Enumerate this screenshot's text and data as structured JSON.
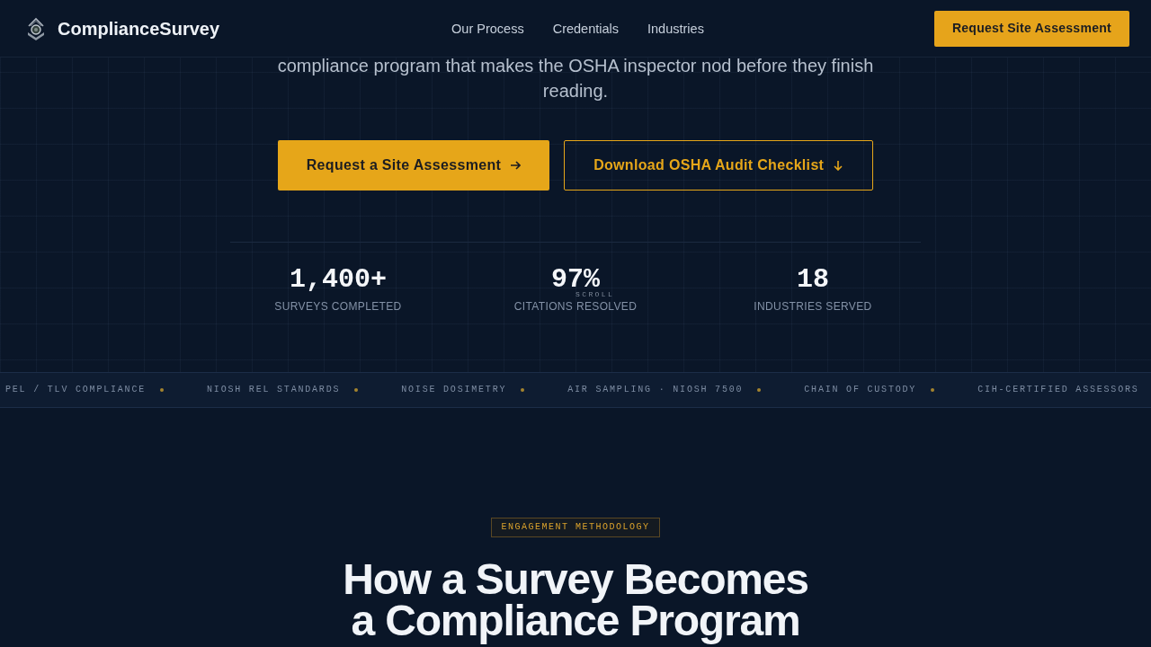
{
  "header": {
    "brand": "ComplianceSurvey",
    "nav": [
      {
        "label": "Our Process"
      },
      {
        "label": "Credentials"
      },
      {
        "label": "Industries"
      }
    ],
    "cta": "Request Site Assessment"
  },
  "hero": {
    "intro": "compliance program that makes the OSHA inspector nod before they finish reading.",
    "buttons": [
      {
        "label": "Request a Site Assessment",
        "kind": "primary"
      },
      {
        "label": "Download OSHA Audit Checklist",
        "kind": "outline"
      }
    ],
    "stats": [
      {
        "value": "1,400+",
        "label": "SURVEYS COMPLETED"
      },
      {
        "value": "97%",
        "label": "CITATIONS RESOLVED"
      },
      {
        "value": "18",
        "label": "INDUSTRIES SERVED"
      }
    ],
    "scroll_hint": "SCROLL"
  },
  "ticker": [
    "PEL / TLV COMPLIANCE",
    "NIOSH REL STANDARDS",
    "NOISE DOSIMETRY",
    "AIR SAMPLING · NIOSH 7500",
    "CHAIN OF CUSTODY",
    "CIH-CERTIFIED ASSESSORS"
  ],
  "methodology": {
    "badge": "ENGAGEMENT METHODOLOGY",
    "heading": "How a Survey Becomes a Compliance Program"
  }
}
